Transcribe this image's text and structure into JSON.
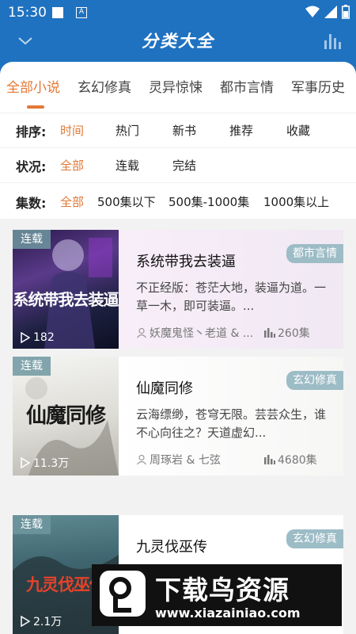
{
  "status_bar": {
    "time": "15:30"
  },
  "header": {
    "title": "分类大全"
  },
  "tabs": [
    {
      "label": "全部小说",
      "active": true
    },
    {
      "label": "玄幻修真",
      "active": false
    },
    {
      "label": "灵异惊悚",
      "active": false
    },
    {
      "label": "都市言情",
      "active": false
    },
    {
      "label": "军事历史",
      "active": false
    }
  ],
  "filters": {
    "sort": {
      "label": "排序:",
      "options": [
        "时间",
        "热门",
        "新书",
        "推荐",
        "收藏"
      ],
      "selected": "时间"
    },
    "status": {
      "label": "状况:",
      "options": [
        "全部",
        "连载",
        "完结"
      ],
      "selected": "全部"
    },
    "episodes": {
      "label": "集数:",
      "options": [
        "全部",
        "500集以下",
        "500集-1000集",
        "1000集以上"
      ],
      "selected": "全部"
    }
  },
  "books": [
    {
      "badge": "连载",
      "plays": "182",
      "cover_text": "系统带我去装逼",
      "title": "系统带我去装逼",
      "genre": "都市言情",
      "description": "不正经版：苍茫大地，装逼为道。一草一木，即可装逼。...",
      "author": "妖魔鬼怪丶老道 & ...",
      "episodes": "260集"
    },
    {
      "badge": "连载",
      "plays": "11.3万",
      "cover_text": "仙魔同修",
      "title": "仙魔同修",
      "genre": "玄幻修真",
      "description": "云海缥缈，苍穹无限。芸芸众生，谁不心向往之？天道虚幻...",
      "author": "周琢岩 & 七弦",
      "episodes": "4680集"
    },
    {
      "badge": "连载",
      "plays": "2.1万",
      "cover_text": "九灵伐巫传",
      "title": "九灵伐巫传",
      "genre": "玄幻修真",
      "description": "",
      "author": "",
      "episodes": ""
    }
  ],
  "watermark": {
    "text": "下载鸟资源",
    "url": "www.xiazainiao.com"
  },
  "colors": {
    "header": "#1f72c0",
    "accent": "#e27835",
    "tag": "#9cbcc6"
  }
}
